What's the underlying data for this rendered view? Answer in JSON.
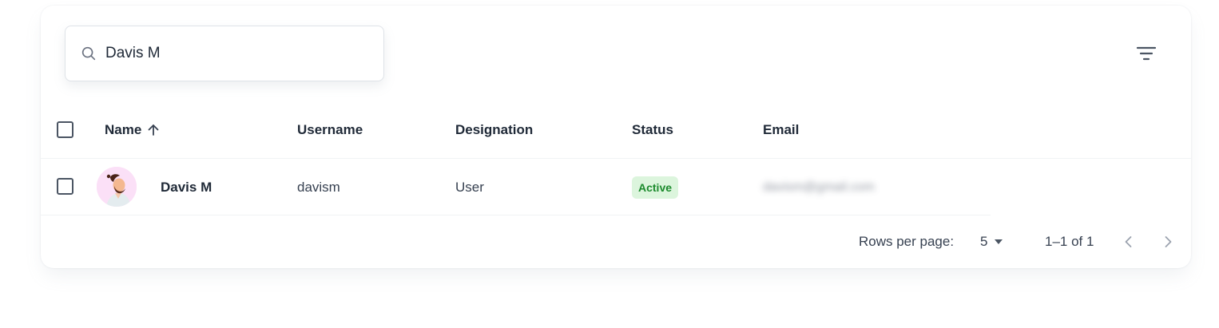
{
  "search": {
    "value": "Davis M",
    "icon": "search-icon"
  },
  "toolbar": {
    "filter_icon": "filter-list-icon"
  },
  "table": {
    "columns": [
      {
        "label": "Name",
        "sort": "ascending"
      },
      {
        "label": "Username"
      },
      {
        "label": "Designation"
      },
      {
        "label": "Status"
      },
      {
        "label": "Email"
      }
    ],
    "rows": [
      {
        "name": "Davis M",
        "username": "davism",
        "designation": "User",
        "status": "Active",
        "email": "davism@gmail.com"
      }
    ]
  },
  "pagination": {
    "rows_per_page_label": "Rows per page:",
    "rows_per_page_value": "5",
    "range_text": "1–1 of 1"
  },
  "colors": {
    "status_active_bg": "#dcf5dd",
    "status_active_text": "#1b8a2c",
    "avatar_bg": "#fbe0f7"
  }
}
